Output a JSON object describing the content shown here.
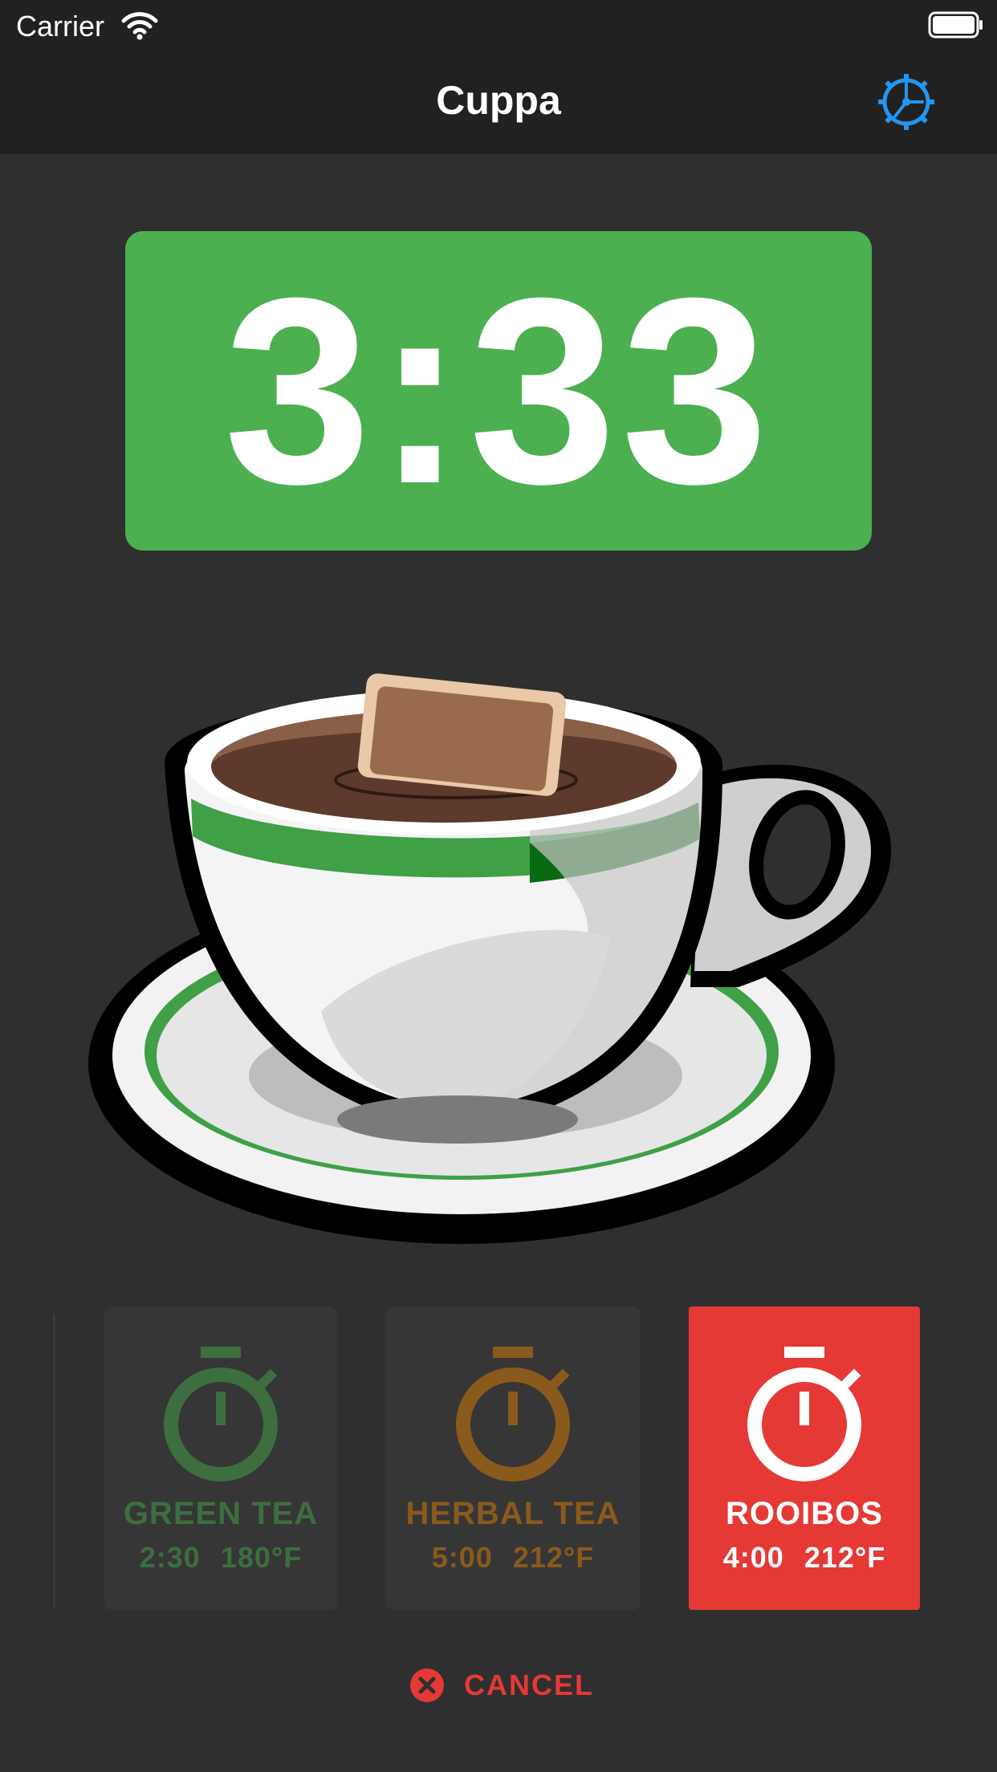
{
  "status_bar": {
    "carrier": "Carrier"
  },
  "nav": {
    "title": "Cuppa"
  },
  "timer": {
    "remaining": "3:33",
    "color": "#4caf50"
  },
  "teas": [
    {
      "name": "GREEN TEA",
      "time": "2:30",
      "temp": "180°F",
      "color": "#3d6e3f",
      "active": false
    },
    {
      "name": "HERBAL TEA",
      "time": "5:00",
      "temp": "212°F",
      "color": "#8a5a1c",
      "active": false
    },
    {
      "name": "ROOIBOS",
      "time": "4:00",
      "temp": "212°F",
      "color": "#ffffff",
      "active": true
    }
  ],
  "cancel": {
    "label": "CANCEL",
    "icon": "close-circle-icon",
    "color": "#e53935"
  },
  "colors": {
    "accent_blue": "#2196f3",
    "background": "#2f2f2f",
    "bar": "#212121"
  }
}
